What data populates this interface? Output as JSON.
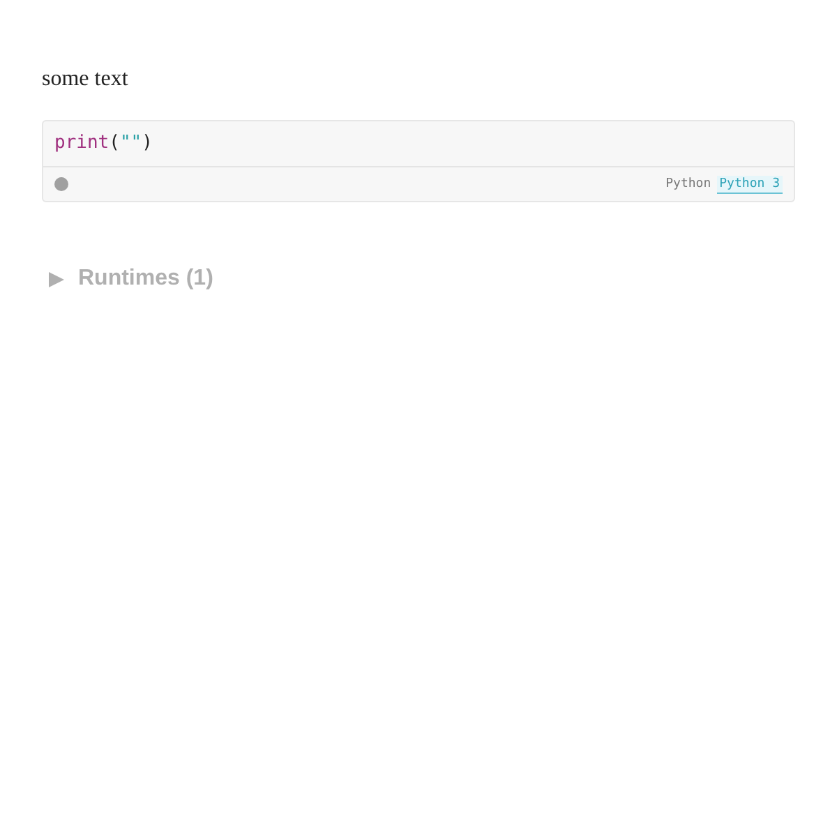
{
  "paragraph": "some text",
  "code_cell": {
    "tokens": [
      {
        "kind": "builtin",
        "text": "print"
      },
      {
        "kind": "punct",
        "text": "("
      },
      {
        "kind": "string",
        "text": "\"\""
      },
      {
        "kind": "punct",
        "text": ")"
      }
    ],
    "busy": false,
    "language": "Python",
    "runtime": "Python 3"
  },
  "runtimes": {
    "label": "Runtimes (1)",
    "expanded": false
  }
}
